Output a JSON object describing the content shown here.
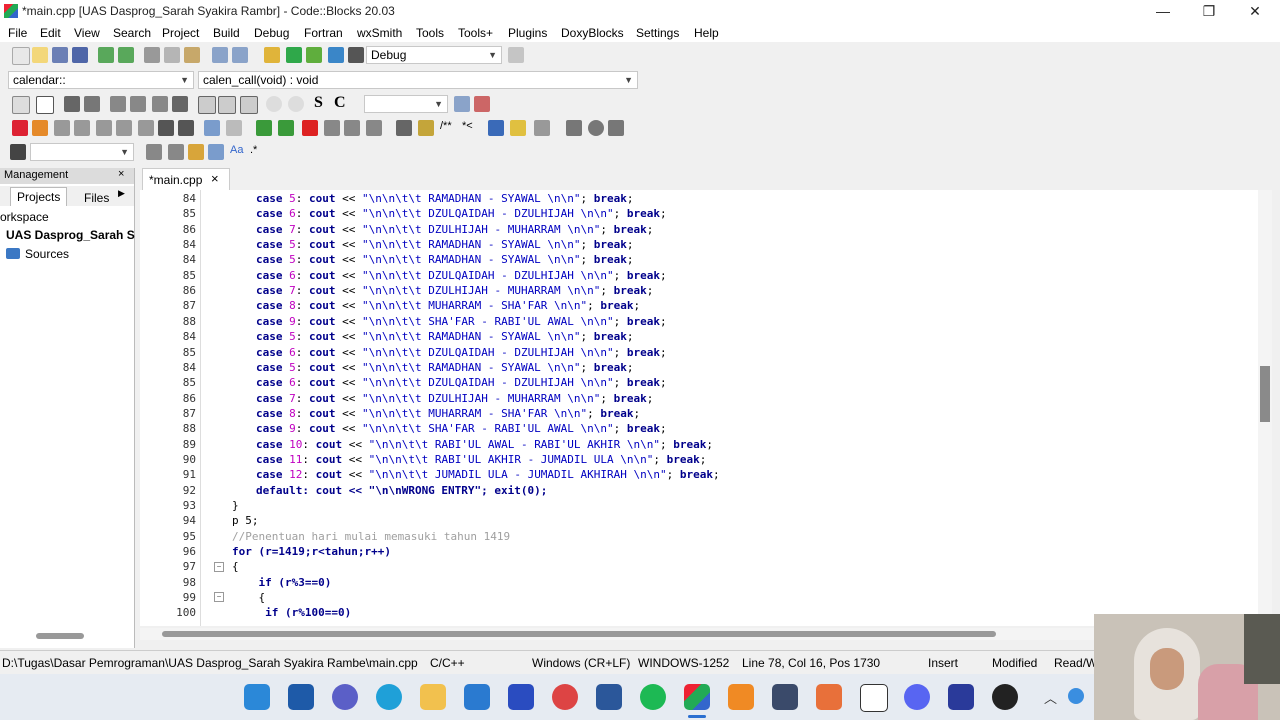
{
  "window": {
    "title": "*main.cpp [UAS Dasprog_Sarah Syakira Rambr] - Code::Blocks 20.03",
    "minimize": "—",
    "maximize": "❐",
    "close": "✕"
  },
  "menu": [
    "File",
    "Edit",
    "View",
    "Search",
    "Project",
    "Build",
    "Debug",
    "Fortran",
    "wxSmith",
    "Tools",
    "Tools+",
    "Plugins",
    "DoxyBlocks",
    "Settings",
    "Help"
  ],
  "toolbar": {
    "build_target": "Debug",
    "scope": "calendar::",
    "function": "calen_call(void) : void"
  },
  "management": {
    "header": "Management",
    "tabs": [
      "Projects",
      "Files"
    ],
    "workspace": "orkspace",
    "project": "UAS Dasprog_Sarah S",
    "sources": "Sources"
  },
  "editor": {
    "tab_label": "*main.cpp",
    "lines": [
      {
        "ln": "84",
        "kind": "case",
        "n": "5",
        "s": "\"\\n\\n\\t\\t RAMADHAN - SYAWAL \\n\\n\""
      },
      {
        "ln": "85",
        "kind": "case",
        "n": "6",
        "s": "\"\\n\\n\\t\\t DZULQAIDAH - DZULHIJAH \\n\\n\""
      },
      {
        "ln": "86",
        "kind": "case",
        "n": "7",
        "s": "\"\\n\\n\\t\\t DZULHIJAH - MUHARRAM \\n\\n\""
      },
      {
        "ln": "84",
        "kind": "case",
        "n": "5",
        "s": "\"\\n\\n\\t\\t RAMADHAN - SYAWAL \\n\\n\""
      },
      {
        "ln": "84",
        "kind": "case",
        "n": "5",
        "s": "\"\\n\\n\\t\\t RAMADHAN - SYAWAL \\n\\n\""
      },
      {
        "ln": "85",
        "kind": "case",
        "n": "6",
        "s": "\"\\n\\n\\t\\t DZULQAIDAH - DZULHIJAH \\n\\n\""
      },
      {
        "ln": "86",
        "kind": "case",
        "n": "7",
        "s": "\"\\n\\n\\t\\t DZULHIJAH - MUHARRAM \\n\\n\""
      },
      {
        "ln": "87",
        "kind": "case",
        "n": "8",
        "s": "\"\\n\\n\\t\\t MUHARRAM - SHA'FAR \\n\\n\""
      },
      {
        "ln": "88",
        "kind": "case",
        "n": "9",
        "s": "\"\\n\\n\\t\\t SHA'FAR - RABI'UL AWAL \\n\\n\""
      },
      {
        "ln": "84",
        "kind": "case",
        "n": "5",
        "s": "\"\\n\\n\\t\\t RAMADHAN - SYAWAL \\n\\n\""
      },
      {
        "ln": "85",
        "kind": "case",
        "n": "6",
        "s": "\"\\n\\n\\t\\t DZULQAIDAH - DZULHIJAH \\n\\n\""
      },
      {
        "ln": "84",
        "kind": "case",
        "n": "5",
        "s": "\"\\n\\n\\t\\t RAMADHAN - SYAWAL \\n\\n\""
      },
      {
        "ln": "85",
        "kind": "case",
        "n": "6",
        "s": "\"\\n\\n\\t\\t DZULQAIDAH - DZULHIJAH \\n\\n\""
      },
      {
        "ln": "86",
        "kind": "case",
        "n": "7",
        "s": "\"\\n\\n\\t\\t DZULHIJAH - MUHARRAM \\n\\n\""
      },
      {
        "ln": "87",
        "kind": "case",
        "n": "8",
        "s": "\"\\n\\n\\t\\t MUHARRAM - SHA'FAR \\n\\n\""
      },
      {
        "ln": "88",
        "kind": "case",
        "n": "9",
        "s": "\"\\n\\n\\t\\t SHA'FAR - RABI'UL AWAL \\n\\n\""
      },
      {
        "ln": "89",
        "kind": "case",
        "n": "10",
        "s": "\"\\n\\n\\t\\t RABI'UL AWAL - RABI'UL AKHIR \\n\\n\""
      },
      {
        "ln": "90",
        "kind": "case",
        "n": "11",
        "s": "\"\\n\\n\\t\\t RABI'UL AKHIR - JUMADIL ULA \\n\\n\""
      },
      {
        "ln": "91",
        "kind": "case",
        "n": "12",
        "s": "\"\\n\\n\\t\\t JUMADIL ULA - JUMADIL AKHIRAH \\n\\n\""
      },
      {
        "ln": "92",
        "kind": "default",
        "text": "default: cout << \"\\n\\nWRONG ENTRY\"; exit(0);"
      },
      {
        "ln": "93",
        "kind": "plain",
        "text": "}"
      },
      {
        "ln": "94",
        "kind": "plain",
        "text": "p 5;"
      },
      {
        "ln": "95",
        "kind": "comment",
        "text": "//Penentuan hari mulai memasuki tahun 1419"
      },
      {
        "ln": "96",
        "kind": "for",
        "text": "for (r=1419;r<tahun;r++)"
      },
      {
        "ln": "97",
        "kind": "plain",
        "text": "{"
      },
      {
        "ln": "98",
        "kind": "if",
        "text": "    if (r%3==0)"
      },
      {
        "ln": "99",
        "kind": "plain",
        "text": "    {"
      },
      {
        "ln": "100",
        "kind": "if",
        "text": "     if (r%100==0)"
      }
    ]
  },
  "status": {
    "path": "D:\\Tugas\\Dasar Pemrograman\\UAS Dasprog_Sarah Syakira Rambe\\main.cpp",
    "lang": "C/C++",
    "eol": "Windows (CR+LF)",
    "encoding": "WINDOWS-1252",
    "position": "Line 78, Col 16, Pos 1730",
    "mode": "Insert",
    "modified": "Modified",
    "rw": "Read/W"
  },
  "colors": {
    "keyword": "#00008b",
    "string": "#0000c0",
    "comment": "#a0a0a0"
  }
}
